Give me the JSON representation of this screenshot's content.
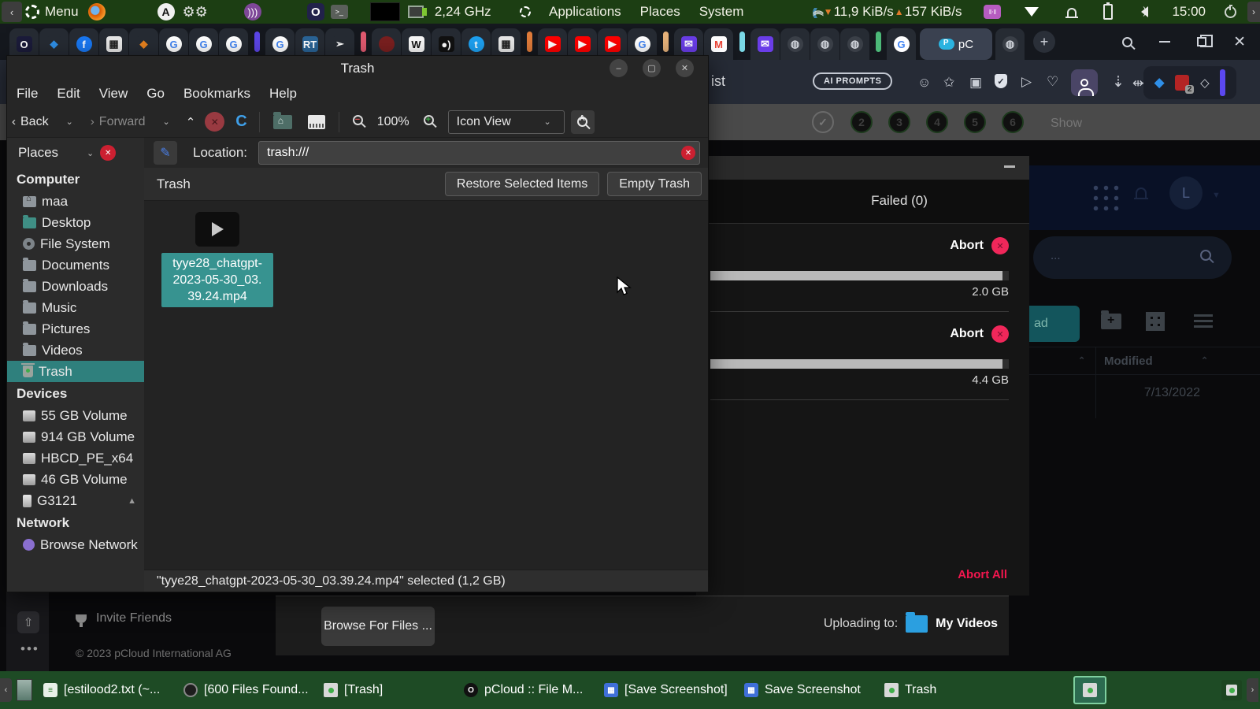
{
  "top_panel": {
    "menu": "Menu",
    "cpu": "2,24 GHz",
    "applications": "Applications",
    "places": "Places",
    "system": "System",
    "net_down": "11,9 KiB/s",
    "net_up": "157 KiB/s",
    "time": "15:00"
  },
  "browser": {
    "url_fragment": "ist",
    "ai_prompts": "AI PROMPTS",
    "ext_badge": "2",
    "active_tab": "pC",
    "tabs": [
      {
        "name": "opera-tab",
        "kind": "fav",
        "glyph": "O",
        "bg": "#1b1b3a",
        "fg": "#fff",
        "circle": false
      },
      {
        "name": "diamond-tab",
        "kind": "fav",
        "glyph": "◆",
        "bg": "#262b33",
        "fg": "#2f8fe8",
        "circle": false
      },
      {
        "name": "facebook-tab",
        "kind": "fav",
        "glyph": "f",
        "bg": "#1877f2",
        "fg": "#fff",
        "circle": true
      },
      {
        "name": "bank-tab",
        "kind": "fav",
        "glyph": "▦",
        "bg": "#e8e8e8",
        "fg": "#222",
        "circle": false
      },
      {
        "name": "metamask-tab",
        "kind": "fav",
        "glyph": "◆",
        "bg": "#262b33",
        "fg": "#e8821e",
        "circle": false
      },
      {
        "name": "google-tab",
        "kind": "fav",
        "glyph": "G",
        "bg": "#fff",
        "fg": "#4285F4",
        "circle": true
      },
      {
        "name": "google-tab",
        "kind": "fav",
        "glyph": "G",
        "bg": "#fff",
        "fg": "#4285F4",
        "circle": true
      },
      {
        "name": "google-tab",
        "kind": "fav",
        "glyph": "G",
        "bg": "#fff",
        "fg": "#4285F4",
        "circle": true
      },
      {
        "name": "tab-group-purple",
        "kind": "bar",
        "color": "#5b45e6"
      },
      {
        "name": "google-tab",
        "kind": "fav",
        "glyph": "G",
        "bg": "#fff",
        "fg": "#4285F4",
        "circle": true
      },
      {
        "name": "rt-tab",
        "kind": "fav",
        "glyph": "RT",
        "bg": "#2a6496",
        "fg": "#fff",
        "circle": false
      },
      {
        "name": "emi-tab",
        "kind": "fav",
        "glyph": "➢",
        "bg": "#262b33",
        "fg": "#fff",
        "circle": false
      },
      {
        "name": "tab-group-red",
        "kind": "bar",
        "color": "#e05a70"
      },
      {
        "name": "darkred-tab",
        "kind": "fav",
        "glyph": "",
        "bg": "#7a1f1f",
        "fg": "#fff",
        "circle": true
      },
      {
        "name": "wikipedia-tab",
        "kind": "fav",
        "glyph": "W",
        "bg": "#f8f8f8",
        "fg": "#111",
        "circle": false
      },
      {
        "name": "medium-tab",
        "kind": "fav",
        "glyph": "●)",
        "bg": "#111",
        "fg": "#fff",
        "circle": false
      },
      {
        "name": "twitter-tab",
        "kind": "fav",
        "glyph": "t",
        "bg": "#1da1f2",
        "fg": "#fff",
        "circle": true
      },
      {
        "name": "bank-tab",
        "kind": "fav",
        "glyph": "▦",
        "bg": "#e8e8e8",
        "fg": "#222",
        "circle": false
      },
      {
        "name": "tab-group-orange",
        "kind": "bar",
        "color": "#e07b3a"
      },
      {
        "name": "youtube-tab",
        "kind": "fav",
        "glyph": "▶",
        "bg": "#f00",
        "fg": "#fff",
        "circle": false
      },
      {
        "name": "youtube-tab",
        "kind": "fav",
        "glyph": "▶",
        "bg": "#f00",
        "fg": "#fff",
        "circle": false
      },
      {
        "name": "youtube-tab",
        "kind": "fav",
        "glyph": "▶",
        "bg": "#f00",
        "fg": "#fff",
        "circle": false
      },
      {
        "name": "google-tab",
        "kind": "fav",
        "glyph": "G",
        "bg": "#fff",
        "fg": "#4285F4",
        "circle": true
      },
      {
        "name": "tab-group-tan",
        "kind": "bar",
        "color": "#e6b27a"
      },
      {
        "name": "mail-tab",
        "kind": "fav",
        "glyph": "✉",
        "bg": "#6a3de8",
        "fg": "#fff",
        "circle": false
      },
      {
        "name": "gmail-tab",
        "kind": "fav",
        "glyph": "M",
        "bg": "#fff",
        "fg": "#ea4335",
        "circle": false
      },
      {
        "name": "tab-group-cyan",
        "kind": "bar",
        "color": "#7ad8e6"
      },
      {
        "name": "mail-tab",
        "kind": "fav",
        "glyph": "✉",
        "bg": "#6a3de8",
        "fg": "#fff",
        "circle": false
      },
      {
        "name": "globe-tab",
        "kind": "fav",
        "glyph": "◍",
        "bg": "#3a3f47",
        "fg": "#cfd3da",
        "circle": true
      },
      {
        "name": "globe-tab",
        "kind": "fav",
        "glyph": "◍",
        "bg": "#3a3f47",
        "fg": "#cfd3da",
        "circle": true
      },
      {
        "name": "globe-tab",
        "kind": "fav",
        "glyph": "◍",
        "bg": "#3a3f47",
        "fg": "#cfd3da",
        "circle": true
      },
      {
        "name": "tab-group-green",
        "kind": "bar",
        "color": "#4cb878"
      },
      {
        "name": "google-tab",
        "kind": "fav",
        "glyph": "G",
        "bg": "#fff",
        "fg": "#4285F4",
        "circle": true
      },
      {
        "name": "pcloud-tab-active",
        "kind": "active"
      },
      {
        "name": "globe-tab",
        "kind": "fav",
        "glyph": "◍",
        "bg": "#3a3f47",
        "fg": "#cfd3da",
        "circle": true
      },
      {
        "name": "new-tab-button",
        "kind": "plus",
        "glyph": "+"
      }
    ]
  },
  "page_behind": {
    "steps": [
      "2",
      "3",
      "4",
      "5",
      "6"
    ],
    "show": "Show",
    "avatar": "L",
    "modified": "Modified",
    "date": "7/13/2022",
    "upload_fragment": "ad",
    "search_placeholder": "...",
    "invite": "Invite Friends",
    "copyright": "© 2023 pCloud International AG"
  },
  "trash_window": {
    "title": "Trash",
    "menus": [
      "File",
      "Edit",
      "View",
      "Go",
      "Bookmarks",
      "Help"
    ],
    "toolbar": {
      "back": "Back",
      "forward": "Forward",
      "zoom": "100%",
      "view_mode": "Icon View"
    },
    "location_label": "Location:",
    "location_value": "trash:///",
    "sidebar_header": "Places",
    "sidebar_sections": [
      {
        "header": "Computer",
        "items": [
          {
            "label": "maa",
            "icon": "home"
          },
          {
            "label": "Desktop",
            "icon": "folder-teal"
          },
          {
            "label": "File System",
            "icon": "disc"
          },
          {
            "label": "Documents",
            "icon": "folder"
          },
          {
            "label": "Downloads",
            "icon": "folder"
          },
          {
            "label": "Music",
            "icon": "folder"
          },
          {
            "label": "Pictures",
            "icon": "folder"
          },
          {
            "label": "Videos",
            "icon": "folder"
          },
          {
            "label": "Trash",
            "icon": "trash",
            "selected": true
          }
        ]
      },
      {
        "header": "Devices",
        "items": [
          {
            "label": "55 GB Volume",
            "icon": "drive"
          },
          {
            "label": "914 GB Volume",
            "icon": "drive"
          },
          {
            "label": "HBCD_PE_x64",
            "icon": "drive"
          },
          {
            "label": "46 GB Volume",
            "icon": "drive"
          },
          {
            "label": "G3121",
            "icon": "phone",
            "eject": true
          }
        ]
      },
      {
        "header": "Network",
        "items": [
          {
            "label": "Browse Network",
            "icon": "network"
          }
        ]
      }
    ],
    "content_title": "Trash",
    "restore_button": "Restore Selected Items",
    "empty_button": "Empty Trash",
    "file_name_lines": [
      "tyye28_chatgpt-",
      "2023-05-30_03.",
      "39.24.mp4"
    ],
    "status": "\"tyye28_chatgpt-2023-05-30_03.39.24.mp4\" selected (1,2 GB)"
  },
  "upload_panel": {
    "failed_tab": "Failed (0)",
    "uploads": [
      {
        "abort": "Abort",
        "size": "2.0 GB",
        "progress": 98
      },
      {
        "abort": "Abort",
        "size": "4.4 GB",
        "progress": 98
      }
    ],
    "abort_all": "Abort All",
    "browse_button": "Browse For Files ...",
    "uploading_to": "Uploading to:",
    "target_folder": "My Videos"
  },
  "taskbar": {
    "items": [
      {
        "label": "[estilood2.txt (~...",
        "icon": "text-doc"
      },
      {
        "label": "[600 Files Found...",
        "icon": "search-app"
      },
      {
        "label": "[Trash]",
        "icon": "trash"
      },
      {
        "label": "pCloud :: File M...",
        "icon": "opera"
      },
      {
        "label": "[Save Screenshot]",
        "icon": "screenshot"
      },
      {
        "label": "Save Screenshot",
        "icon": "screenshot"
      },
      {
        "label": "Trash",
        "icon": "trash"
      }
    ]
  }
}
